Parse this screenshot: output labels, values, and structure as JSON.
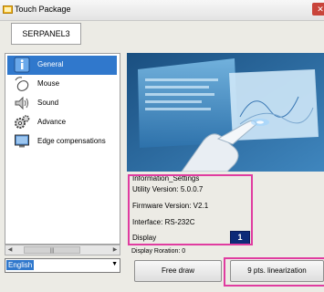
{
  "window": {
    "title": "Touch Package",
    "close_label": "✕"
  },
  "device": {
    "name": "SERPANEL3"
  },
  "sidebar": {
    "items": [
      {
        "label": "General",
        "icon": "info-icon",
        "selected": true
      },
      {
        "label": "Mouse",
        "icon": "mouse-icon"
      },
      {
        "label": "Sound",
        "icon": "speaker-icon"
      },
      {
        "label": "Advance",
        "icon": "gears-icon"
      },
      {
        "label": "Edge compensations",
        "icon": "monitor-icon"
      }
    ]
  },
  "scrollbar": {
    "left_arrow": "◀",
    "right_arrow": "▶",
    "grip": "|||"
  },
  "language": {
    "selected": "English",
    "arrow": "▼"
  },
  "info": {
    "title": "Information_Settings",
    "utility": "Utility Version: 5.0.0.7",
    "firmware": "Firmware Version: V2.1",
    "interface": "Interface: RS-232C",
    "display_label": "Display",
    "display_value": "1",
    "rotation": "Display Roration: 0"
  },
  "buttons": {
    "free_draw": "Free draw",
    "linearization": "9 pts. linearization"
  },
  "colors": {
    "accent": "#3078cc",
    "highlight": "#e03ca0",
    "display_badge": "#0e2a78"
  }
}
